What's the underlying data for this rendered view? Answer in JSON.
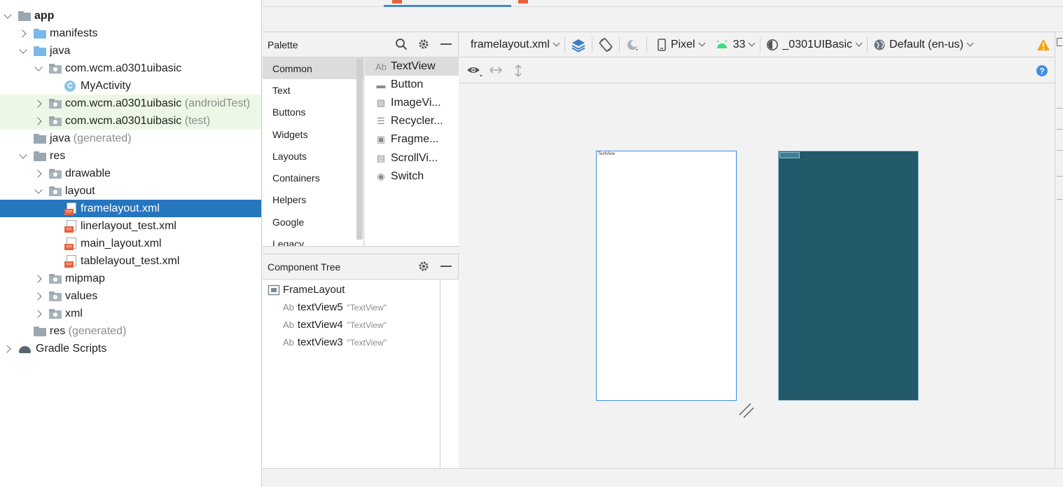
{
  "project": {
    "rows": [
      {
        "label": "app",
        "suffix": "",
        "indent": 0,
        "chevron": "down",
        "icon": "folder-module",
        "bold": true
      },
      {
        "label": "manifests",
        "suffix": "",
        "indent": 1,
        "chevron": "right",
        "icon": "folder-blue"
      },
      {
        "label": "java",
        "suffix": "",
        "indent": 1,
        "chevron": "down",
        "icon": "folder-blue"
      },
      {
        "label": "com.wcm.a0301uibasic",
        "suffix": "",
        "indent": 2,
        "chevron": "down",
        "icon": "package"
      },
      {
        "label": "MyActivity",
        "suffix": "",
        "indent": 3,
        "chevron": "none",
        "icon": "class"
      },
      {
        "label": "com.wcm.a0301uibasic",
        "suffix": " (androidTest)",
        "indent": 2,
        "chevron": "right",
        "icon": "package",
        "tinted": true
      },
      {
        "label": "com.wcm.a0301uibasic",
        "suffix": " (test)",
        "indent": 2,
        "chevron": "right",
        "icon": "package",
        "tinted": true
      },
      {
        "label": "java",
        "suffix": " (generated)",
        "indent": 1,
        "chevron": "none",
        "icon": "folder-generated"
      },
      {
        "label": "res",
        "suffix": "",
        "indent": 1,
        "chevron": "down",
        "icon": "folder-res"
      },
      {
        "label": "drawable",
        "suffix": "",
        "indent": 2,
        "chevron": "right",
        "icon": "package"
      },
      {
        "label": "layout",
        "suffix": "",
        "indent": 2,
        "chevron": "down",
        "icon": "package"
      },
      {
        "label": "framelayout.xml",
        "suffix": "",
        "indent": 3,
        "chevron": "none",
        "icon": "xml",
        "selected": true
      },
      {
        "label": "linerlayout_test.xml",
        "suffix": "",
        "indent": 3,
        "chevron": "none",
        "icon": "xml"
      },
      {
        "label": "main_layout.xml",
        "suffix": "",
        "indent": 3,
        "chevron": "none",
        "icon": "xml"
      },
      {
        "label": "tablelayout_test.xml",
        "suffix": "",
        "indent": 3,
        "chevron": "none",
        "icon": "xml"
      },
      {
        "label": "mipmap",
        "suffix": "",
        "indent": 2,
        "chevron": "right",
        "icon": "package"
      },
      {
        "label": "values",
        "suffix": "",
        "indent": 2,
        "chevron": "right",
        "icon": "package"
      },
      {
        "label": "xml",
        "suffix": "",
        "indent": 2,
        "chevron": "right",
        "icon": "package"
      },
      {
        "label": "res",
        "suffix": " (generated)",
        "indent": 1,
        "chevron": "none",
        "icon": "folder-res"
      },
      {
        "label": "Gradle Scripts",
        "suffix": "",
        "indent": 0,
        "chevron": "right",
        "icon": "gradle"
      }
    ]
  },
  "palette": {
    "title": "Palette",
    "categories": [
      "Common",
      "Text",
      "Buttons",
      "Widgets",
      "Layouts",
      "Containers",
      "Helpers",
      "Google",
      "Legacy"
    ],
    "active_category": "Common",
    "items": [
      {
        "label": "TextView",
        "icon": "Ab"
      },
      {
        "label": "Button",
        "icon": "▬"
      },
      {
        "label": "ImageVi...",
        "icon": "▨"
      },
      {
        "label": "Recycler...",
        "icon": "☰"
      },
      {
        "label": "Fragme...",
        "icon": "▣"
      },
      {
        "label": "ScrollVi...",
        "icon": "▤"
      },
      {
        "label": "Switch",
        "icon": "◉"
      }
    ]
  },
  "component_tree": {
    "title": "Component Tree",
    "root": "FrameLayout",
    "children": [
      {
        "id": "textView5",
        "text": "\"TextView\""
      },
      {
        "id": "textView4",
        "text": "\"TextView\""
      },
      {
        "id": "textView3",
        "text": "\"TextView\""
      }
    ]
  },
  "toolbar": {
    "file": "framelayout.xml",
    "device": "Pixel",
    "api": "33",
    "theme": "_0301UIBasic",
    "locale": "Default (en-us)"
  },
  "canvas": {
    "design_textview": "TextView"
  },
  "colors": {
    "selection": "#2675bf",
    "blueprint": "#225a6b",
    "warning": "#f0a30a",
    "design_border": "#3d8ee0"
  }
}
